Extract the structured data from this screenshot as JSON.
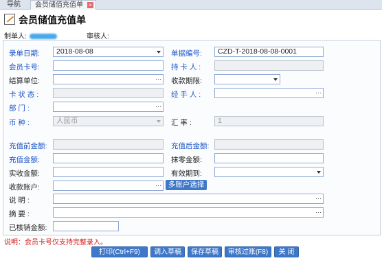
{
  "tabs": {
    "nav": "导航",
    "active": "会员储值充值单",
    "close": "×"
  },
  "title": "会员储值充值单",
  "meta": {
    "creator_label": "制单人:",
    "reviewer_label": "审核人:"
  },
  "labels": {
    "date": "录单日期:",
    "bill_no": "单据编号:",
    "card_no": "会员卡号:",
    "holder": "持 卡 人 :",
    "settle_unit": "结算单位:",
    "pay_term": "收款期限:",
    "card_status": "卡 状 态 :",
    "handler": "经 手 人 :",
    "dept": "部 门 :",
    "currency": "币 种 :",
    "rate": "汇 率 :",
    "before_amt": "充值前金额:",
    "after_amt": "充值后金额:",
    "charge_amt": "充值金额:",
    "wipe_amt": "抹零金额:",
    "received_amt": "实收金额:",
    "valid_until": "有效期到:",
    "account": "收款账户:",
    "remark": "说 明 :",
    "summary": "摘 要 :",
    "written_off": "已核销金额:"
  },
  "values": {
    "date": "2018-08-08",
    "bill_no": "CZD-T-2018-08-08-0001",
    "currency": "人民币",
    "rate": "1"
  },
  "buttons": {
    "multi_account": "多账户选择",
    "print": "打印(Ctrl+F9)",
    "load_draft": "调入草稿",
    "save_draft": "保存草稿",
    "approve": "审核过账(F8)",
    "close": "关 闭"
  },
  "note": "说明：会员卡号仅支持完整录入。"
}
